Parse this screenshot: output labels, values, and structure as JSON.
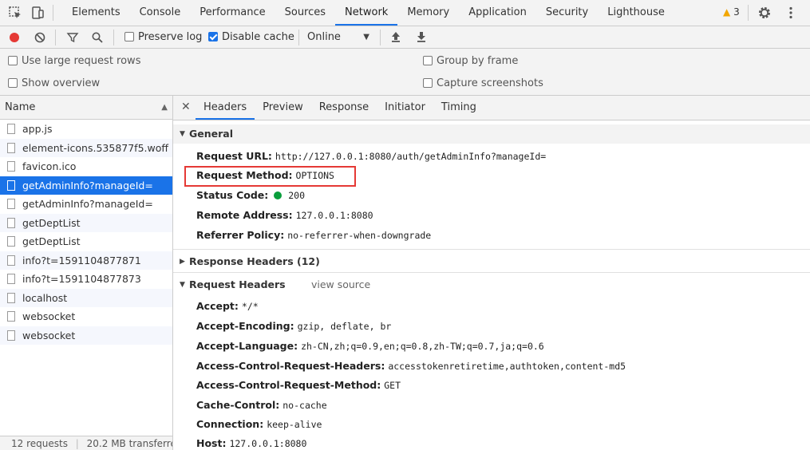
{
  "devtools": {
    "tabs": [
      "Elements",
      "Console",
      "Performance",
      "Sources",
      "Network",
      "Memory",
      "Application",
      "Security",
      "Lighthouse"
    ],
    "active_tab": "Network",
    "warnings_count": "3"
  },
  "toolbar": {
    "preserve_log": "Preserve log",
    "disable_cache": "Disable cache",
    "throttle": "Online"
  },
  "settings": {
    "large_rows": "Use large request rows",
    "show_overview": "Show overview",
    "group_by_frame": "Group by frame",
    "capture_screenshots": "Capture screenshots"
  },
  "list": {
    "header": "Name",
    "items": [
      "app.js",
      "element-icons.535877f5.woff",
      "favicon.ico",
      "getAdminInfo?manageId=",
      "getAdminInfo?manageId=",
      "getDeptList",
      "getDeptList",
      "info?t=1591104877871",
      "info?t=1591104877873",
      "localhost",
      "websocket",
      "websocket"
    ],
    "status_requests": "12 requests",
    "status_transferred": "20.2 MB transferre"
  },
  "detail": {
    "tabs": [
      "Headers",
      "Preview",
      "Response",
      "Initiator",
      "Timing"
    ],
    "general_title": "General",
    "general": [
      {
        "k": "Request URL:",
        "v": "http://127.0.0.1:8080/auth/getAdminInfo?manageId="
      },
      {
        "k": "Request Method:",
        "v": "OPTIONS"
      },
      {
        "k": "Status Code:",
        "v": "200"
      },
      {
        "k": "Remote Address:",
        "v": "127.0.0.1:8080"
      },
      {
        "k": "Referrer Policy:",
        "v": "no-referrer-when-downgrade"
      }
    ],
    "response_headers_title": "Response Headers (12)",
    "request_headers_title": "Request Headers",
    "view_source": "view source",
    "request_headers": [
      {
        "k": "Accept:",
        "v": "*/*"
      },
      {
        "k": "Accept-Encoding:",
        "v": "gzip, deflate, br"
      },
      {
        "k": "Accept-Language:",
        "v": "zh-CN,zh;q=0.9,en;q=0.8,zh-TW;q=0.7,ja;q=0.6"
      },
      {
        "k": "Access-Control-Request-Headers:",
        "v": "accesstokenretiretime,authtoken,content-md5"
      },
      {
        "k": "Access-Control-Request-Method:",
        "v": "GET"
      },
      {
        "k": "Cache-Control:",
        "v": "no-cache"
      },
      {
        "k": "Connection:",
        "v": "keep-alive"
      },
      {
        "k": "Host:",
        "v": "127.0.0.1:8080"
      }
    ]
  },
  "colors": {
    "accent": "#1a73e8",
    "highlight_box": "#e53935",
    "status_ok": "#0a9e3c",
    "record": "#e53935"
  }
}
